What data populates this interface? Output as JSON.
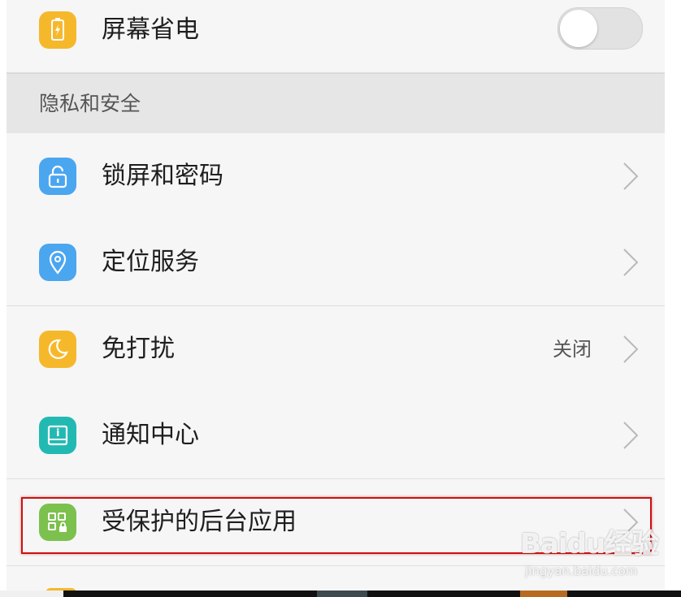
{
  "rows": {
    "screen_saver": {
      "label": "屏幕省电",
      "toggle_on": false
    },
    "lock_screen": {
      "label": "锁屏和密码"
    },
    "location": {
      "label": "定位服务"
    },
    "dnd": {
      "label": "免打扰",
      "value": "关闭"
    },
    "notification": {
      "label": "通知中心"
    },
    "protected_apps": {
      "label": "受保护的后台应用"
    }
  },
  "section": {
    "privacy_title": "隐私和安全"
  },
  "icons": {
    "screen_saver": "battery-lightning-icon",
    "lock_screen": "unlocked-padlock-icon",
    "location": "location-pin-icon",
    "dnd": "crescent-moon-icon",
    "notification": "notification-panel-icon",
    "protected_apps": "app-grid-lock-icon"
  },
  "colors": {
    "yellow": "#f6b82b",
    "blue": "#4ba6f0",
    "teal": "#23b9b3",
    "green": "#7cc14e",
    "highlight": "#cc1111",
    "topbar": "#0c5b7a"
  },
  "watermark": {
    "brand": "Baidu经验",
    "url": "jingyan.baidu.com"
  }
}
